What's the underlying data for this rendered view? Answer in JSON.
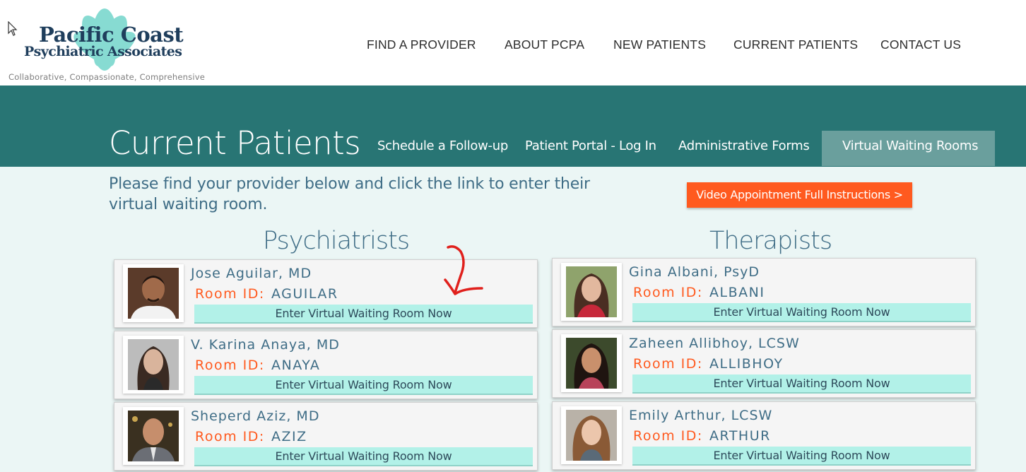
{
  "header": {
    "logo_line1": "Pacific Coast",
    "logo_line2": "Psychiatric Associates",
    "tagline": "Collaborative, Compassionate, Comprehensive"
  },
  "nav": [
    "FIND A PROVIDER",
    "ABOUT PCPA",
    "NEW PATIENTS",
    "CURRENT PATIENTS",
    "CONTACT US"
  ],
  "section": {
    "title": "Current Patients",
    "subnav": [
      "Schedule a Follow-up",
      "Patient Portal - Log In",
      "Administrative Forms",
      "Virtual Waiting Rooms"
    ],
    "active_subnav": "Virtual Waiting Rooms"
  },
  "intro_text": "Please find your provider below and click the link to enter their virtual waiting room.",
  "instructions_button": "Video Appointment Full Instructions >",
  "room_label": "Room ID:",
  "enter_label": "Enter Virtual Waiting Room Now",
  "psychiatrists": {
    "title": "Psychiatrists",
    "providers": [
      {
        "name": "Jose Aguilar, MD",
        "room_id": "AGUILAR"
      },
      {
        "name": "V. Karina Anaya, MD",
        "room_id": "ANAYA"
      },
      {
        "name": "Sheperd Aziz, MD",
        "room_id": "AZIZ"
      }
    ]
  },
  "therapists": {
    "title": "Therapists",
    "providers": [
      {
        "name": "Gina Albani, PsyD",
        "room_id": "ALBANI"
      },
      {
        "name": "Zaheen Allibhoy, LCSW",
        "room_id": "ALLIBHOY"
      },
      {
        "name": "Emily Arthur, LCSW",
        "room_id": "ARTHUR"
      }
    ]
  },
  "colors": {
    "teal_band": "#287574",
    "active_tab": "#6a9f9d",
    "content_bg": "#ebf6f5",
    "accent_orange": "#ff5a1f",
    "enter_button": "#b2f1e8",
    "text_blue": "#3f6d86",
    "annotation_red": "#e0201c"
  }
}
